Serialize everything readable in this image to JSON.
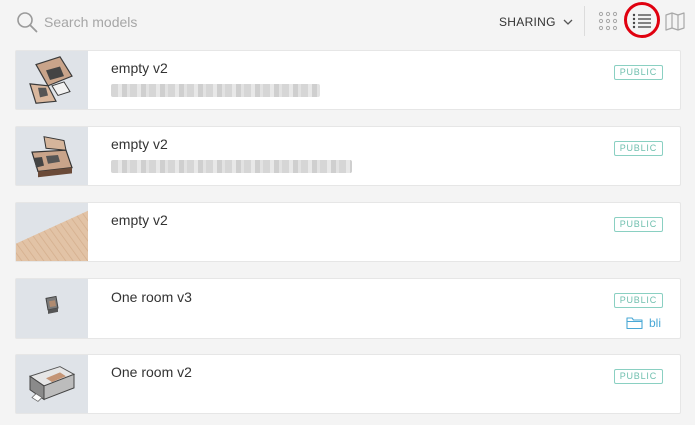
{
  "search": {
    "placeholder": "Search models",
    "value": ""
  },
  "toolbar": {
    "sharing_label": "SHARING",
    "views": [
      {
        "id": "grid",
        "icon": "grid-view-icon",
        "active": false
      },
      {
        "id": "list",
        "icon": "list-view-icon",
        "active": true
      },
      {
        "id": "map",
        "icon": "map-view-icon",
        "active": false
      }
    ],
    "highlight_color": "#e0000f"
  },
  "models": [
    {
      "title": "empty v2",
      "description": "",
      "description_redacted": true,
      "visibility": "PUBLIC",
      "folder": "",
      "thumbnail": "floorplan-dark-icon"
    },
    {
      "title": "empty v2",
      "description": "",
      "description_redacted": true,
      "visibility": "PUBLIC",
      "folder": "",
      "thumbnail": "floorplan-3d-icon"
    },
    {
      "title": "empty v2",
      "description": "",
      "description_redacted": false,
      "visibility": "PUBLIC",
      "folder": "",
      "thumbnail": "wood-floor-icon"
    },
    {
      "title": "One room v3",
      "description": "",
      "description_redacted": false,
      "visibility": "PUBLIC",
      "folder": "bli",
      "thumbnail": "small-room-icon"
    },
    {
      "title": "One room v2",
      "description": "",
      "description_redacted": false,
      "visibility": "PUBLIC",
      "folder": "",
      "thumbnail": "room-3d-icon"
    }
  ],
  "colors": {
    "badge": "#6fbfae",
    "folder": "#4aa8d6",
    "background": "#f4f4f4",
    "thumbnail_bg": "#dfe3e8"
  }
}
